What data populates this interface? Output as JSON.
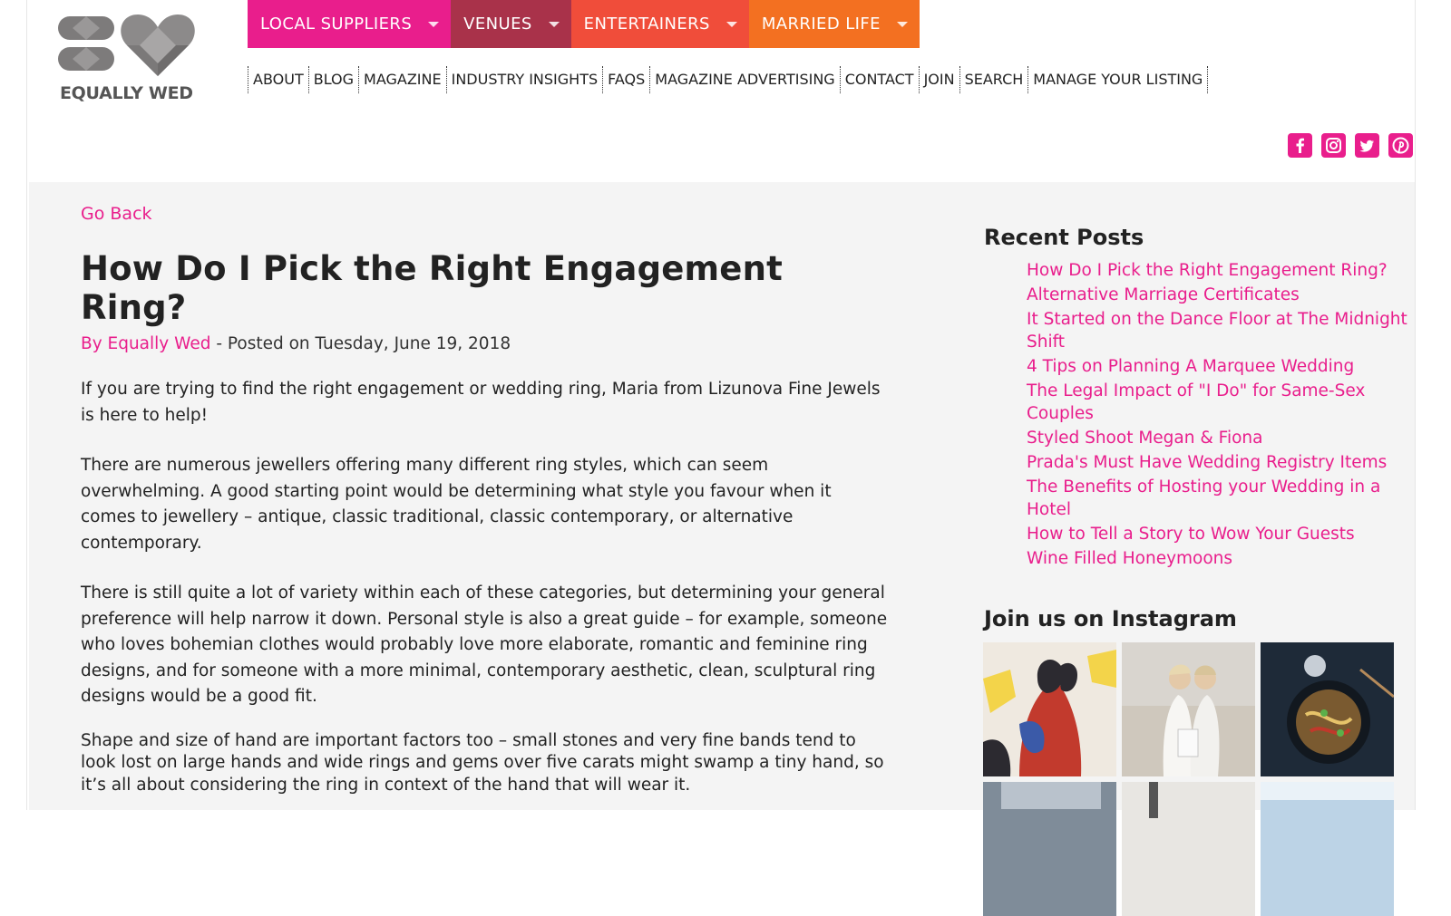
{
  "brand": {
    "name": "EQUALLY WED"
  },
  "main_nav": [
    {
      "label": "LOCAL SUPPLIERS",
      "color": "#e91e8c"
    },
    {
      "label": "VENUES",
      "color": "#a9324a"
    },
    {
      "label": "ENTERTAINERS",
      "color": "#f04d3a"
    },
    {
      "label": "MARRIED LIFE",
      "color": "#f37021"
    }
  ],
  "sub_nav": [
    "ABOUT",
    "BLOG",
    "MAGAZINE",
    "INDUSTRY INSIGHTS",
    "FAQS",
    "MAGAZINE ADVERTISING",
    "CONTACT",
    "JOIN",
    "SEARCH",
    "MANAGE YOUR LISTING"
  ],
  "social": [
    {
      "icon": "facebook-icon"
    },
    {
      "icon": "instagram-icon"
    },
    {
      "icon": "twitter-icon"
    },
    {
      "icon": "pinterest-icon"
    }
  ],
  "accent": "#e91e8c",
  "article": {
    "go_back": "Go Back",
    "title": "How Do I Pick the Right Engagement Ring?",
    "author": "By Equally Wed",
    "posted": " - Posted on Tuesday, June 19, 2018",
    "paragraphs": [
      "If you are trying to find the right engagement or wedding ring, Maria from Lizunova Fine Jewels is here to help!",
      "There are numerous jewellers offering many different ring styles, which can seem overwhelming. A good starting point would be determining what style you favour when it comes to jewellery – antique, classic traditional, classic contemporary, or alternative contemporary.",
      "There is still quite a lot of variety within each of these categories, but determining your general preference will help narrow it down. Personal style is also a great guide – for example, someone who loves bohemian clothes would probably love more elaborate, romantic and feminine ring designs, and for someone with a more minimal, contemporary aesthetic, clean, sculptural ring designs would be a good fit.",
      "Shape and size of hand are important factors too – small stones and very fine bands tend to look lost on large hands and wide rings and gems over five carats might swamp a tiny hand, so it’s all about considering the ring in context of the hand that will wear it."
    ]
  },
  "sidebar": {
    "recent_heading": "Recent Posts",
    "recent_posts": [
      "How Do I Pick the Right Engagement Ring?",
      "Alternative Marriage Certificates",
      "It Started on the Dance Floor at The Midnight Shift",
      "4 Tips on Planning A Marquee Wedding",
      "The Legal Impact of \"I Do\" for Same-Sex Couples",
      "Styled Shoot Megan & Fiona",
      "Prada's Must Have Wedding Registry Items",
      "The Benefits of Hosting your Wedding in a Hotel",
      "How to Tell a Story to Wow Your Guests",
      "Wine Filled Honeymoons"
    ],
    "instagram_heading": "Join us on Instagram"
  }
}
